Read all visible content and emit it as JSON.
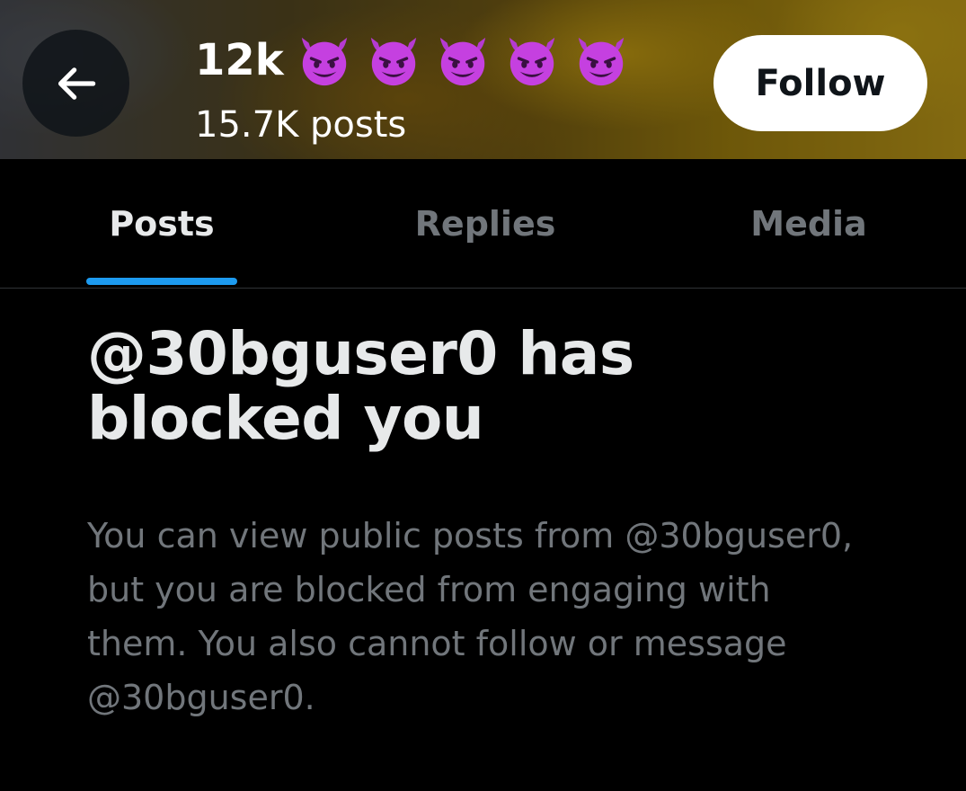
{
  "header": {
    "title": "12k",
    "title_emoji_count": 5,
    "title_emoji_icon": "smiling-devil-icon",
    "emoji_color": "#c540e0",
    "post_count": "15.7K posts",
    "follow_label": "Follow"
  },
  "tabs": [
    {
      "label": "Posts",
      "active": true
    },
    {
      "label": "Replies",
      "active": false
    },
    {
      "label": "Media",
      "active": false
    }
  ],
  "accent_color": "#1d9bf0",
  "block": {
    "title": "@30bguser0 has blocked you",
    "description": "You can view public posts from @30bguser0, but you are blocked from engaging with them. You also cannot follow or message @30bguser0."
  }
}
